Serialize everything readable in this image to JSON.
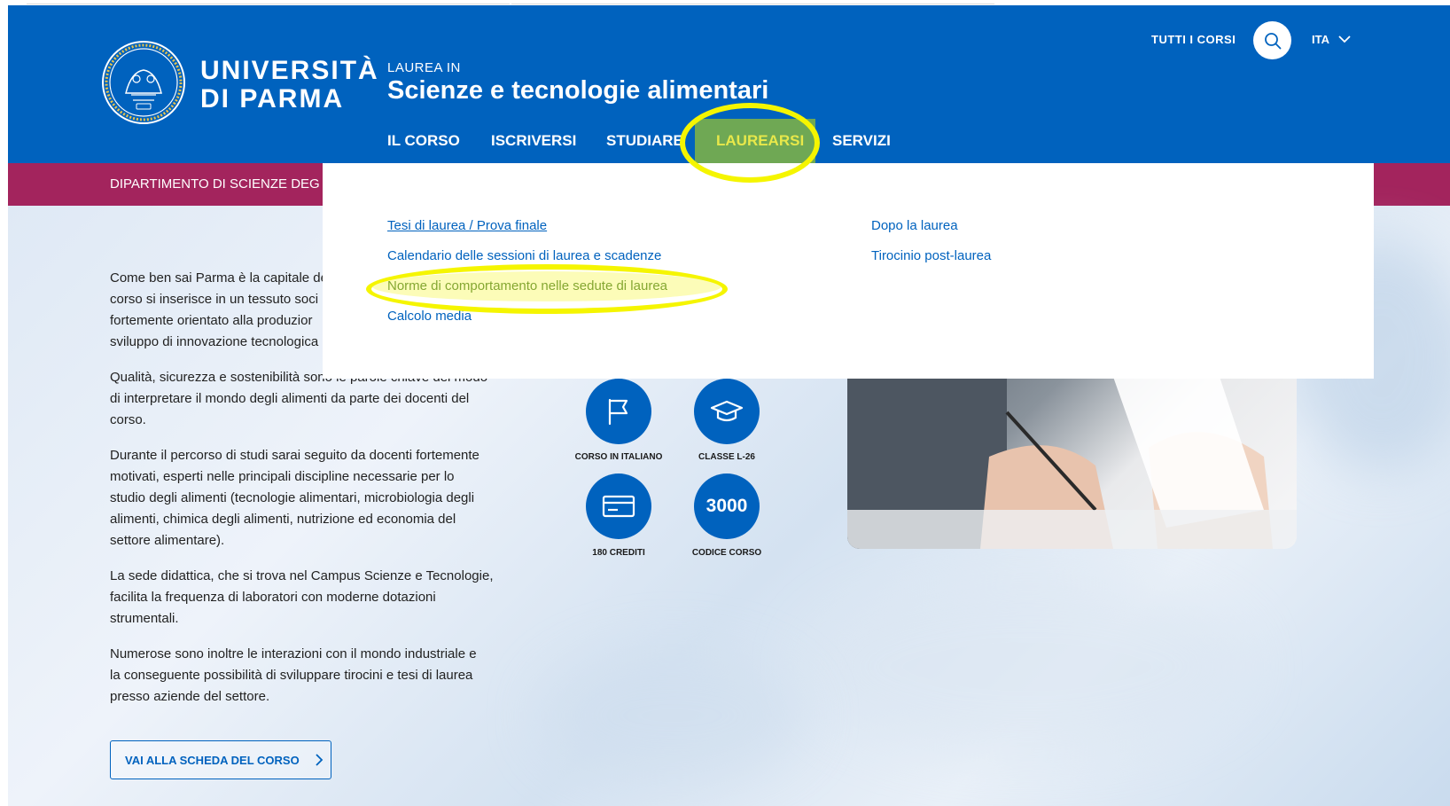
{
  "header": {
    "university_line1": "UNIVERSITÀ",
    "university_line2": "DI PARMA",
    "degree_prefix": "LAUREA IN",
    "course_title": "Scienze e tecnologie alimentari",
    "all_courses_label": "TUTTI I CORSI",
    "language_label": "ITA",
    "nav": [
      {
        "label": "IL CORSO"
      },
      {
        "label": "ISCRIVERSI"
      },
      {
        "label": "STUDIARE"
      },
      {
        "label": "LAUREARSI",
        "active": true
      },
      {
        "label": "SERVIZI"
      }
    ]
  },
  "department": {
    "label": "DIPARTIMENTO DI SCIENZE DEG"
  },
  "dropdown": {
    "left_links": [
      {
        "label": "Tesi di laurea / Prova finale"
      },
      {
        "label": "Calendario delle sessioni di laurea e scadenze"
      },
      {
        "label": "Norme di comportamento nelle sedute di laurea",
        "highlighted": true
      },
      {
        "label": "Calcolo media"
      }
    ],
    "right_links": [
      {
        "label": "Dopo la laurea"
      },
      {
        "label": "Tirocinio post-laurea"
      }
    ]
  },
  "intro": {
    "p1": [
      "Come ben sai Parma è la capitale de",
      "corso si inserisce in un tessuto soci",
      "fortemente orientato alla produzior",
      "sviluppo di innovazione tecnologica"
    ],
    "p2": [
      "Qualità, sicurezza e sostenibilità sono le parole chiave del modo",
      "di interpretare il mondo degli alimenti da parte dei docenti del",
      "corso."
    ],
    "p3": [
      "Durante il percorso di studi sarai seguito da docenti fortemente",
      "motivati, esperti nelle principali discipline necessarie per lo",
      "studio degli alimenti (tecnologie alimentari, microbiologia degli",
      "alimenti, chimica degli alimenti, nutrizione ed  economia del",
      "settore alimentare)."
    ],
    "p4": [
      "La sede didattica, che si trova nel Campus Scienze e Tecnologie,",
      "facilita la frequenza di laboratori con moderne dotazioni",
      "strumentali."
    ],
    "p5": [
      "Numerose sono inoltre le interazioni con il mondo industriale e",
      "la conseguente possibilità di sviluppare tirocini e tesi di laurea",
      "presso aziende del settore."
    ]
  },
  "cta": {
    "label": "VAI ALLA SCHEDA DEL CORSO"
  },
  "features": [
    {
      "icon": "flag-icon",
      "label": "CORSO IN ITALIANO"
    },
    {
      "icon": "graduation-cap-icon",
      "label": "CLASSE L-26"
    },
    {
      "icon": "credit-card-icon",
      "label": "180 CREDITI"
    },
    {
      "value": "3000",
      "label": "CODICE CORSO"
    }
  ],
  "colors": {
    "brand_blue": "#0062be",
    "department_bar": "#a3245d",
    "highlight": "#f5f500",
    "active_nav_bg": "#6fa854"
  }
}
